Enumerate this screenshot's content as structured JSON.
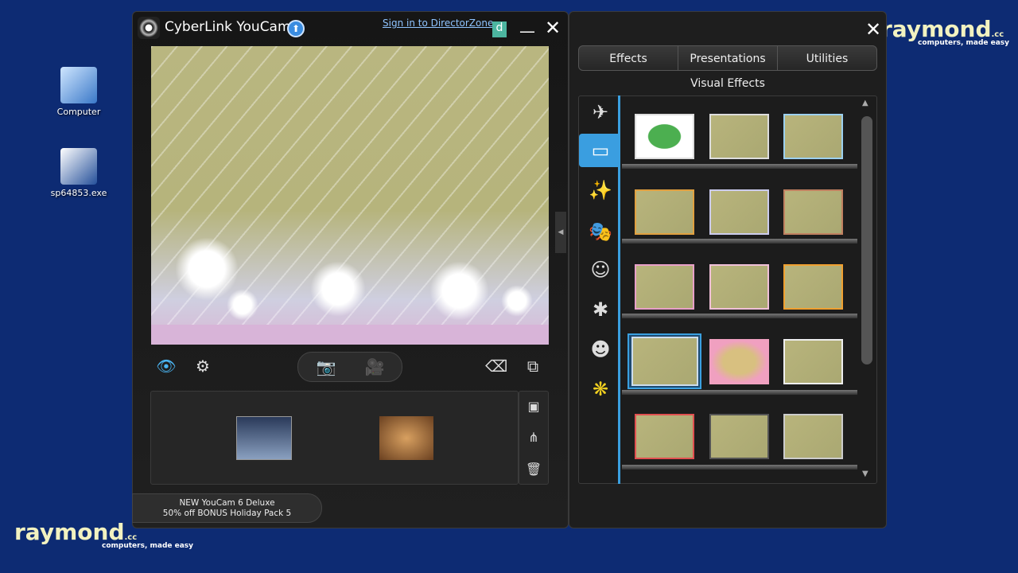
{
  "desktop": {
    "icons": [
      {
        "label": "Computer"
      },
      {
        "label": "sp64853.exe"
      }
    ],
    "watermark": "raymond",
    "watermark_tagline": "computers, made easy",
    "watermark_suffix": ".cc"
  },
  "main_window": {
    "title": "CyberLink YouCam",
    "sign_in_link": "Sign in to DirectorZone",
    "promo_line1": "NEW YouCam 6 Deluxe",
    "promo_line2": "50% off BONUS Holiday Pack 5"
  },
  "effects_panel": {
    "tabs": [
      {
        "label": "Effects",
        "active": true
      },
      {
        "label": "Presentations"
      },
      {
        "label": "Utilities"
      }
    ],
    "section_title": "Visual Effects",
    "categories": [
      "particle-effects",
      "frames",
      "magic",
      "masks",
      "avatars",
      "distortion",
      "emotions",
      "special"
    ],
    "selected_category": "frames",
    "selected_effect_row": 4,
    "selected_effect_col": 1
  },
  "colors": {
    "accent": "#4ab3f0",
    "desktop": "#0d2b73"
  }
}
